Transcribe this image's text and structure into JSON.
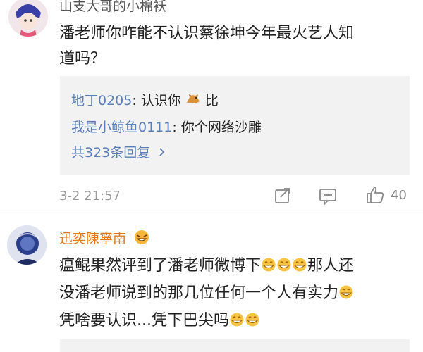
{
  "comments": [
    {
      "username": "山支大哥的小棉袄",
      "text_line1": "潘老师你咋能不认识蔡徐坤今年最火艺人知",
      "text_line2": "道吗？",
      "replies": [
        {
          "name": "地丁0205",
          "text_before": "认识你",
          "text_after": "比"
        },
        {
          "name": "我是小鲸鱼0111",
          "text": "你个网络沙雕"
        }
      ],
      "more_replies": "共323条回复",
      "time": "3-2 21:57",
      "like_count": "40"
    },
    {
      "username": "迅奕陳寧南",
      "text_line1": "瘟鲲果然评到了潘老师微博下",
      "text_line1_after": "那人还",
      "text_line2": "没潘老师说到的那几位任何一个人有实力",
      "text_line3": "凭啥要认识...凭下巴尖吗"
    }
  ],
  "colors": {
    "link": "#5a7fb8",
    "username2": "#e07a1f",
    "meta": "#999999",
    "reply_bg": "#f2f2f2"
  },
  "icons": {
    "repost": "share-icon",
    "comment": "comment-icon",
    "like": "thumbs-up-icon",
    "emoji_grin": "grin-emoji-icon",
    "emoji_horse": "horse-emoji-icon",
    "more_chevron": "chevron-right-icon"
  }
}
